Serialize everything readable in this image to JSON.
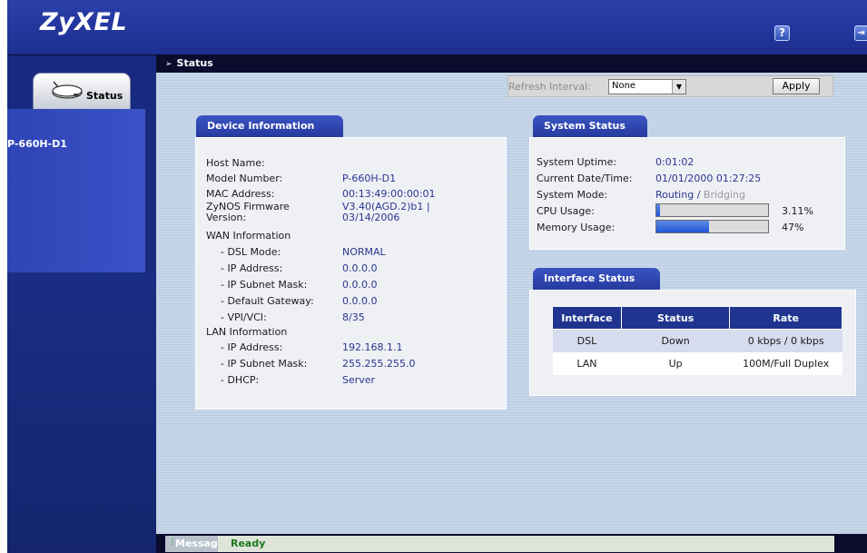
{
  "header": {
    "logo": "ZyXEL",
    "help_icon": "?",
    "logout_icon": "⇥"
  },
  "titlebar": {
    "title": "Status"
  },
  "sidebar": {
    "tab_label": "Status",
    "device_label": "P-660H-D1"
  },
  "refresh": {
    "label": "Refresh Interval:",
    "selected": "None",
    "apply_label": "Apply"
  },
  "device_info": {
    "title": "Device Information",
    "rows": [
      {
        "label": "Host Name:",
        "value": ""
      },
      {
        "label": "Model Number:",
        "value": "P-660H-D1"
      },
      {
        "label": "MAC Address:",
        "value": "00:13:49:00:00:01"
      },
      {
        "label": "ZyNOS Firmware Version:",
        "value": "V3.40(AGD.2)b1 | 03/14/2006"
      }
    ],
    "wan_title": "WAN Information",
    "wan_rows": [
      {
        "label": "- DSL Mode:",
        "value": "NORMAL"
      },
      {
        "label": "- IP Address:",
        "value": "0.0.0.0"
      },
      {
        "label": "- IP Subnet Mask:",
        "value": "0.0.0.0"
      },
      {
        "label": "- Default Gateway:",
        "value": "0.0.0.0"
      },
      {
        "label": "- VPI/VCI:",
        "value": "8/35"
      }
    ],
    "lan_title": "LAN Information",
    "lan_rows": [
      {
        "label": "- IP Address:",
        "value": "192.168.1.1"
      },
      {
        "label": "- IP Subnet Mask:",
        "value": "255.255.255.0"
      },
      {
        "label": "- DHCP:",
        "value": "Server"
      }
    ]
  },
  "system_status": {
    "title": "System Status",
    "uptime_label": "System Uptime:",
    "uptime_value": "0:01:02",
    "datetime_label": "Current Date/Time:",
    "datetime_value": "01/01/2000 01:27:25",
    "mode_label": "System Mode:",
    "mode_active": "Routing",
    "mode_sep": "/",
    "mode_inactive": "Bridging",
    "cpu_label": "CPU Usage:",
    "cpu_value": "3.11%",
    "cpu_fraction": 0.0311,
    "mem_label": "Memory Usage:",
    "mem_value": "47%",
    "mem_fraction": 0.47
  },
  "interface_status": {
    "title": "Interface Status",
    "columns": [
      "Interface",
      "Status",
      "Rate"
    ],
    "rows": [
      [
        "DSL",
        "Down",
        "0 kbps / 0 kbps"
      ],
      [
        "LAN",
        "Up",
        "100M/Full Duplex"
      ]
    ]
  },
  "message": {
    "label": "Message",
    "value": "Ready"
  }
}
